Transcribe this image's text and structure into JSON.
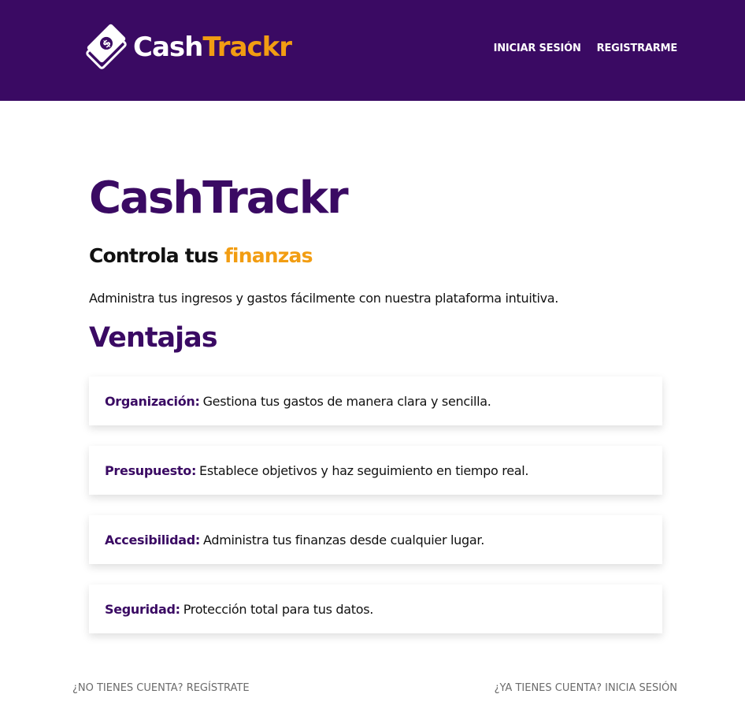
{
  "header": {
    "logo_text_a": "Cash",
    "logo_text_b": "Trackr",
    "nav": [
      {
        "label": "INICIAR SESIÓN"
      },
      {
        "label": "REGISTRARME"
      }
    ]
  },
  "main": {
    "title": "CashTrackr",
    "tagline_a": "Controla tus ",
    "tagline_b": "finanzas",
    "intro": "Administra tus ingresos y gastos fácilmente con nuestra plataforma intuitiva.",
    "section_title": "Ventajas",
    "features": [
      {
        "key": "Organización:",
        "text": "Gestiona tus gastos de manera clara y sencilla."
      },
      {
        "key": "Presupuesto:",
        "text": "Establece objetivos y haz seguimiento en tiempo real."
      },
      {
        "key": "Accesibilidad:",
        "text": "Administra tus finanzas desde cualquier lugar."
      },
      {
        "key": "Seguridad:",
        "text": "Protección total para tus datos."
      }
    ]
  },
  "footer": {
    "register_link": "¿NO TIENES CUENTA? REGÍSTRATE",
    "login_link": "¿YA TIENES CUENTA? INICIA SESIÓN"
  },
  "colors": {
    "brand_purple": "#3a0a63",
    "accent_orange": "#f29d12"
  },
  "icons": {
    "logo": "money-bill-dollar-icon"
  }
}
